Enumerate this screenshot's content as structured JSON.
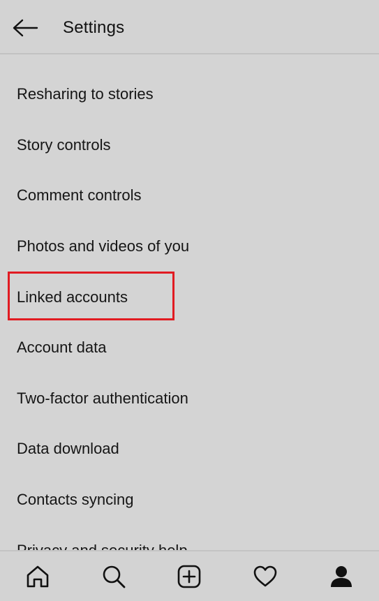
{
  "header": {
    "title": "Settings",
    "back_icon": "back-arrow-icon"
  },
  "settings_items": [
    {
      "label": "Resharing to stories"
    },
    {
      "label": "Story controls"
    },
    {
      "label": "Comment controls"
    },
    {
      "label": "Photos and videos of you"
    },
    {
      "label": "Linked accounts",
      "highlighted": true
    },
    {
      "label": "Account data"
    },
    {
      "label": "Two-factor authentication"
    },
    {
      "label": "Data download"
    },
    {
      "label": "Contacts syncing"
    },
    {
      "label": "Privacy and security help"
    }
  ],
  "highlight_color": "#e11b22",
  "bottom_nav": [
    {
      "icon": "home-icon"
    },
    {
      "icon": "search-icon"
    },
    {
      "icon": "new-post-icon"
    },
    {
      "icon": "activity-heart-icon"
    },
    {
      "icon": "profile-icon",
      "active": true
    }
  ]
}
